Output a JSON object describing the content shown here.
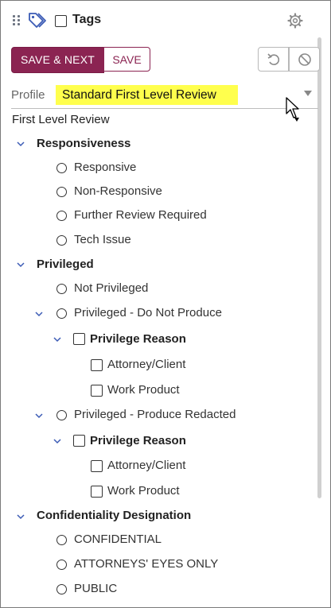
{
  "header": {
    "title": "Tags",
    "icons": [
      "drag-handle-icon",
      "tag-icon",
      "gear-icon"
    ]
  },
  "toolbar": {
    "save_next_label": "SAVE & NEXT",
    "save_label": "SAVE",
    "undo_icon": "undo-icon",
    "clear_icon": "block-icon"
  },
  "profile": {
    "label": "Profile",
    "selected": "Standard First Level Review"
  },
  "tree": {
    "title": "First Level Review",
    "responsiveness": {
      "label": "Responsiveness",
      "options": [
        "Responsive",
        "Non-Responsive",
        "Further Review Required",
        "Tech Issue"
      ]
    },
    "privileged": {
      "label": "Privileged",
      "not_privileged": "Not Privileged",
      "do_not_produce": {
        "label": "Privileged - Do Not Produce",
        "reason": {
          "label": "Privilege Reason",
          "options": [
            "Attorney/Client",
            "Work Product"
          ]
        }
      },
      "produce_redacted": {
        "label": "Privileged - Produce Redacted",
        "reason": {
          "label": "Privilege Reason",
          "options": [
            "Attorney/Client",
            "Work Product"
          ]
        }
      }
    },
    "confidentiality": {
      "label": "Confidentiality Designation",
      "options": [
        "CONFIDENTIAL",
        "ATTORNEYS' EYES ONLY",
        "PUBLIC"
      ]
    }
  },
  "colors": {
    "primary": "#8b2452",
    "highlight": "#ffff4d",
    "chevron": "#3b5bb5"
  }
}
